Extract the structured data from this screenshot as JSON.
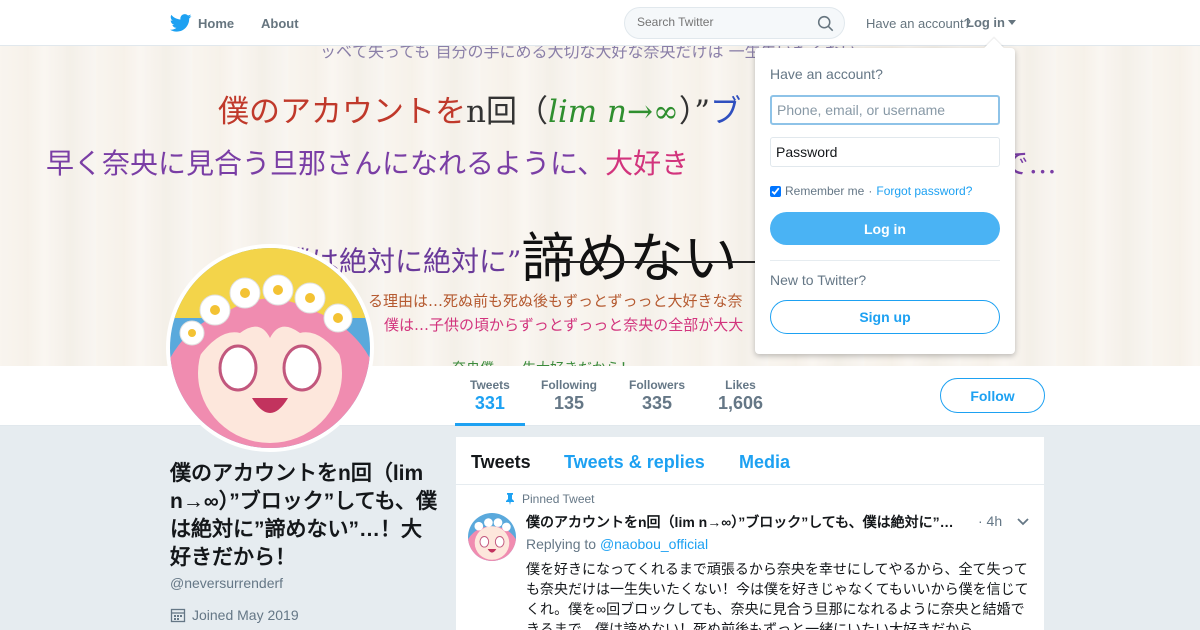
{
  "nav": {
    "home_label": "Home",
    "about_label": "About",
    "search_placeholder": "Search Twitter",
    "have_account": "Have an account?",
    "login_label": "Log in",
    "brand_color": "#1da1f2",
    "icons": [
      "twitter-bird-icon",
      "search-icon",
      "caret-down-icon"
    ]
  },
  "banner": {
    "line0": "ッベて失っても 自分の手にめる大切な大好な奈央だけは 一生失いたくない",
    "line1_a": "僕のアカウントを",
    "line1_b": "n回（",
    "line1_c": "lim n→∞",
    "line1_d": "）”",
    "line1_e": "ブ",
    "line2_a": "早く奈央に見合う旦那さんになれるように、",
    "line2_b": "大好き",
    "line2_c": "きるまで…",
    "line3_a": "僕は絶対に絶対に”",
    "line3_b": "諦めない",
    "line4": "る理由は…死ぬ前も死ぬ後もずっとずっっと大好きな奈",
    "line5": "僕は…子供の頃からずっとずっっと奈央の全部が大大",
    "line6": "奈央僕…一生大好きだから！"
  },
  "profile_nav": {
    "stats": [
      {
        "label": "Tweets",
        "value": "331"
      },
      {
        "label": "Following",
        "value": "135"
      },
      {
        "label": "Followers",
        "value": "335"
      },
      {
        "label": "Likes",
        "value": "1,606"
      }
    ],
    "follow_label": "Follow"
  },
  "profile": {
    "name": "僕のアカウントをn回（lim n→∞）”ブロック”しても、僕は絶対に”諦めない”…！大好きだから！",
    "handle": "@neversurrenderf",
    "joined": "Joined May 2019"
  },
  "timeline": {
    "tabs": [
      "Tweets",
      "Tweets & replies",
      "Media"
    ],
    "tweet": {
      "pinned_label": "Pinned Tweet",
      "name": "僕のアカウントをn回（lim n→∞）”ブロック”しても、僕は絶対に”諦めない”…！大好きだから！",
      "time": "· 4h",
      "replying_prefix": "Replying to",
      "replying_handle": "@naobou_official",
      "text": "僕を好きになってくれるまで頑張るから奈央を幸せにしてやるから、全て失っても奈央だけは一生失いたくない！今は僕を好きじゃなくてもいいから僕を信じてくれ。僕を∞回ブロックしても、奈央に見合う旦那になれるように奈央と結婚できるまで、僕は諦めない！死ぬ前後もずっと一緒にいたい大好きだから"
    }
  },
  "login_dropdown": {
    "title": "Have an account?",
    "username_placeholder": "Phone, email, or username",
    "password_placeholder": "Password",
    "remember_label": "Remember me",
    "separator": "·",
    "forgot_label": "Forgot password?",
    "login_button": "Log in",
    "new_label": "New to Twitter?",
    "signup_button": "Sign up"
  }
}
